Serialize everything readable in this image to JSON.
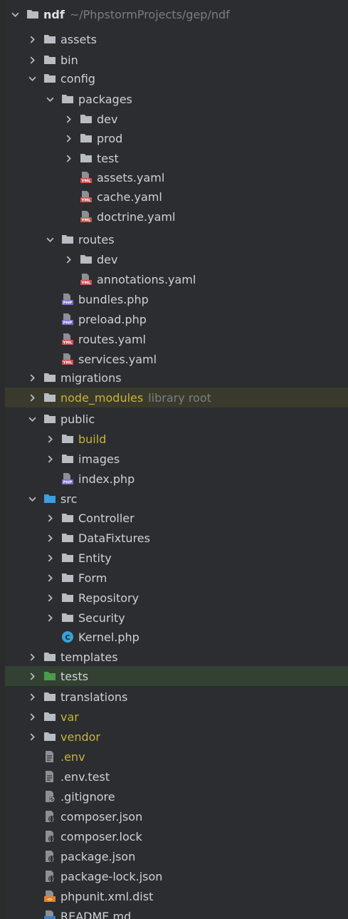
{
  "project": {
    "name": "ndf",
    "path": "~/PhpstormProjects/gep/ndf"
  },
  "colors": {
    "background": "#2b2d30",
    "folder": "#b8bcc3",
    "source_folder": "#3d9ee0",
    "test_folder": "#4c9a4e",
    "excluded_text": "#c9b33a",
    "muted_text": "#7a7e85"
  },
  "tree": [
    {
      "label": "assets",
      "icon": "folder-icon",
      "state": "collapsed"
    },
    {
      "label": "bin",
      "icon": "folder-icon",
      "state": "collapsed"
    },
    {
      "label": "config",
      "icon": "folder-icon",
      "state": "expanded"
    },
    {
      "label": "packages",
      "icon": "folder-icon",
      "state": "expanded"
    },
    {
      "label": "dev",
      "icon": "folder-icon",
      "state": "collapsed"
    },
    {
      "label": "prod",
      "icon": "folder-icon",
      "state": "collapsed"
    },
    {
      "label": "test",
      "icon": "folder-icon",
      "state": "collapsed"
    },
    {
      "label": "assets.yaml",
      "icon": "yaml-file-icon",
      "icon_text": "YML"
    },
    {
      "label": "cache.yaml",
      "icon": "yaml-file-icon",
      "icon_text": "YML"
    },
    {
      "label": "doctrine.yaml",
      "icon": "yaml-file-icon",
      "icon_text": "YML"
    },
    {
      "label": "routes",
      "icon": "folder-icon",
      "state": "expanded"
    },
    {
      "label": "dev",
      "icon": "folder-icon",
      "state": "collapsed"
    },
    {
      "label": "annotations.yaml",
      "icon": "yaml-file-icon",
      "icon_text": "YML"
    },
    {
      "label": "bundles.php",
      "icon": "php-file-icon",
      "icon_text": "PHP"
    },
    {
      "label": "preload.php",
      "icon": "php-file-icon",
      "icon_text": "PHP"
    },
    {
      "label": "routes.yaml",
      "icon": "yaml-file-icon",
      "icon_text": "YML"
    },
    {
      "label": "services.yaml",
      "icon": "yaml-file-icon",
      "icon_text": "YML"
    },
    {
      "label": "migrations",
      "icon": "folder-icon",
      "state": "collapsed"
    },
    {
      "label": "node_modules",
      "icon": "folder-icon",
      "state": "collapsed",
      "suffix": "library root"
    },
    {
      "label": "public",
      "icon": "folder-icon",
      "state": "expanded"
    },
    {
      "label": "build",
      "icon": "folder-icon",
      "state": "collapsed"
    },
    {
      "label": "images",
      "icon": "folder-icon",
      "state": "collapsed"
    },
    {
      "label": "index.php",
      "icon": "php-file-icon",
      "icon_text": "PHP"
    },
    {
      "label": "src",
      "icon": "source-folder-icon",
      "state": "expanded"
    },
    {
      "label": "Controller",
      "icon": "folder-icon",
      "state": "collapsed"
    },
    {
      "label": "DataFixtures",
      "icon": "folder-icon",
      "state": "collapsed"
    },
    {
      "label": "Entity",
      "icon": "folder-icon",
      "state": "collapsed"
    },
    {
      "label": "Form",
      "icon": "folder-icon",
      "state": "collapsed"
    },
    {
      "label": "Repository",
      "icon": "folder-icon",
      "state": "collapsed"
    },
    {
      "label": "Security",
      "icon": "folder-icon",
      "state": "collapsed"
    },
    {
      "label": "Kernel.php",
      "icon": "php-class-icon",
      "icon_text": "C"
    },
    {
      "label": "templates",
      "icon": "folder-icon",
      "state": "collapsed"
    },
    {
      "label": "tests",
      "icon": "test-folder-icon",
      "state": "collapsed"
    },
    {
      "label": "translations",
      "icon": "folder-icon",
      "state": "collapsed"
    },
    {
      "label": "var",
      "icon": "folder-icon",
      "state": "collapsed"
    },
    {
      "label": "vendor",
      "icon": "folder-icon",
      "state": "collapsed"
    },
    {
      "label": ".env",
      "icon": "env-file-icon"
    },
    {
      "label": ".env.test",
      "icon": "env-file-icon"
    },
    {
      "label": ".gitignore",
      "icon": "gitignore-file-icon"
    },
    {
      "label": "composer.json",
      "icon": "json-file-icon"
    },
    {
      "label": "composer.lock",
      "icon": "json-file-icon"
    },
    {
      "label": "package.json",
      "icon": "json-file-icon"
    },
    {
      "label": "package-lock.json",
      "icon": "json-file-icon"
    },
    {
      "label": "phpunit.xml.dist",
      "icon": "xml-file-icon"
    },
    {
      "label": "README.md",
      "icon": "markdown-file-icon"
    }
  ]
}
